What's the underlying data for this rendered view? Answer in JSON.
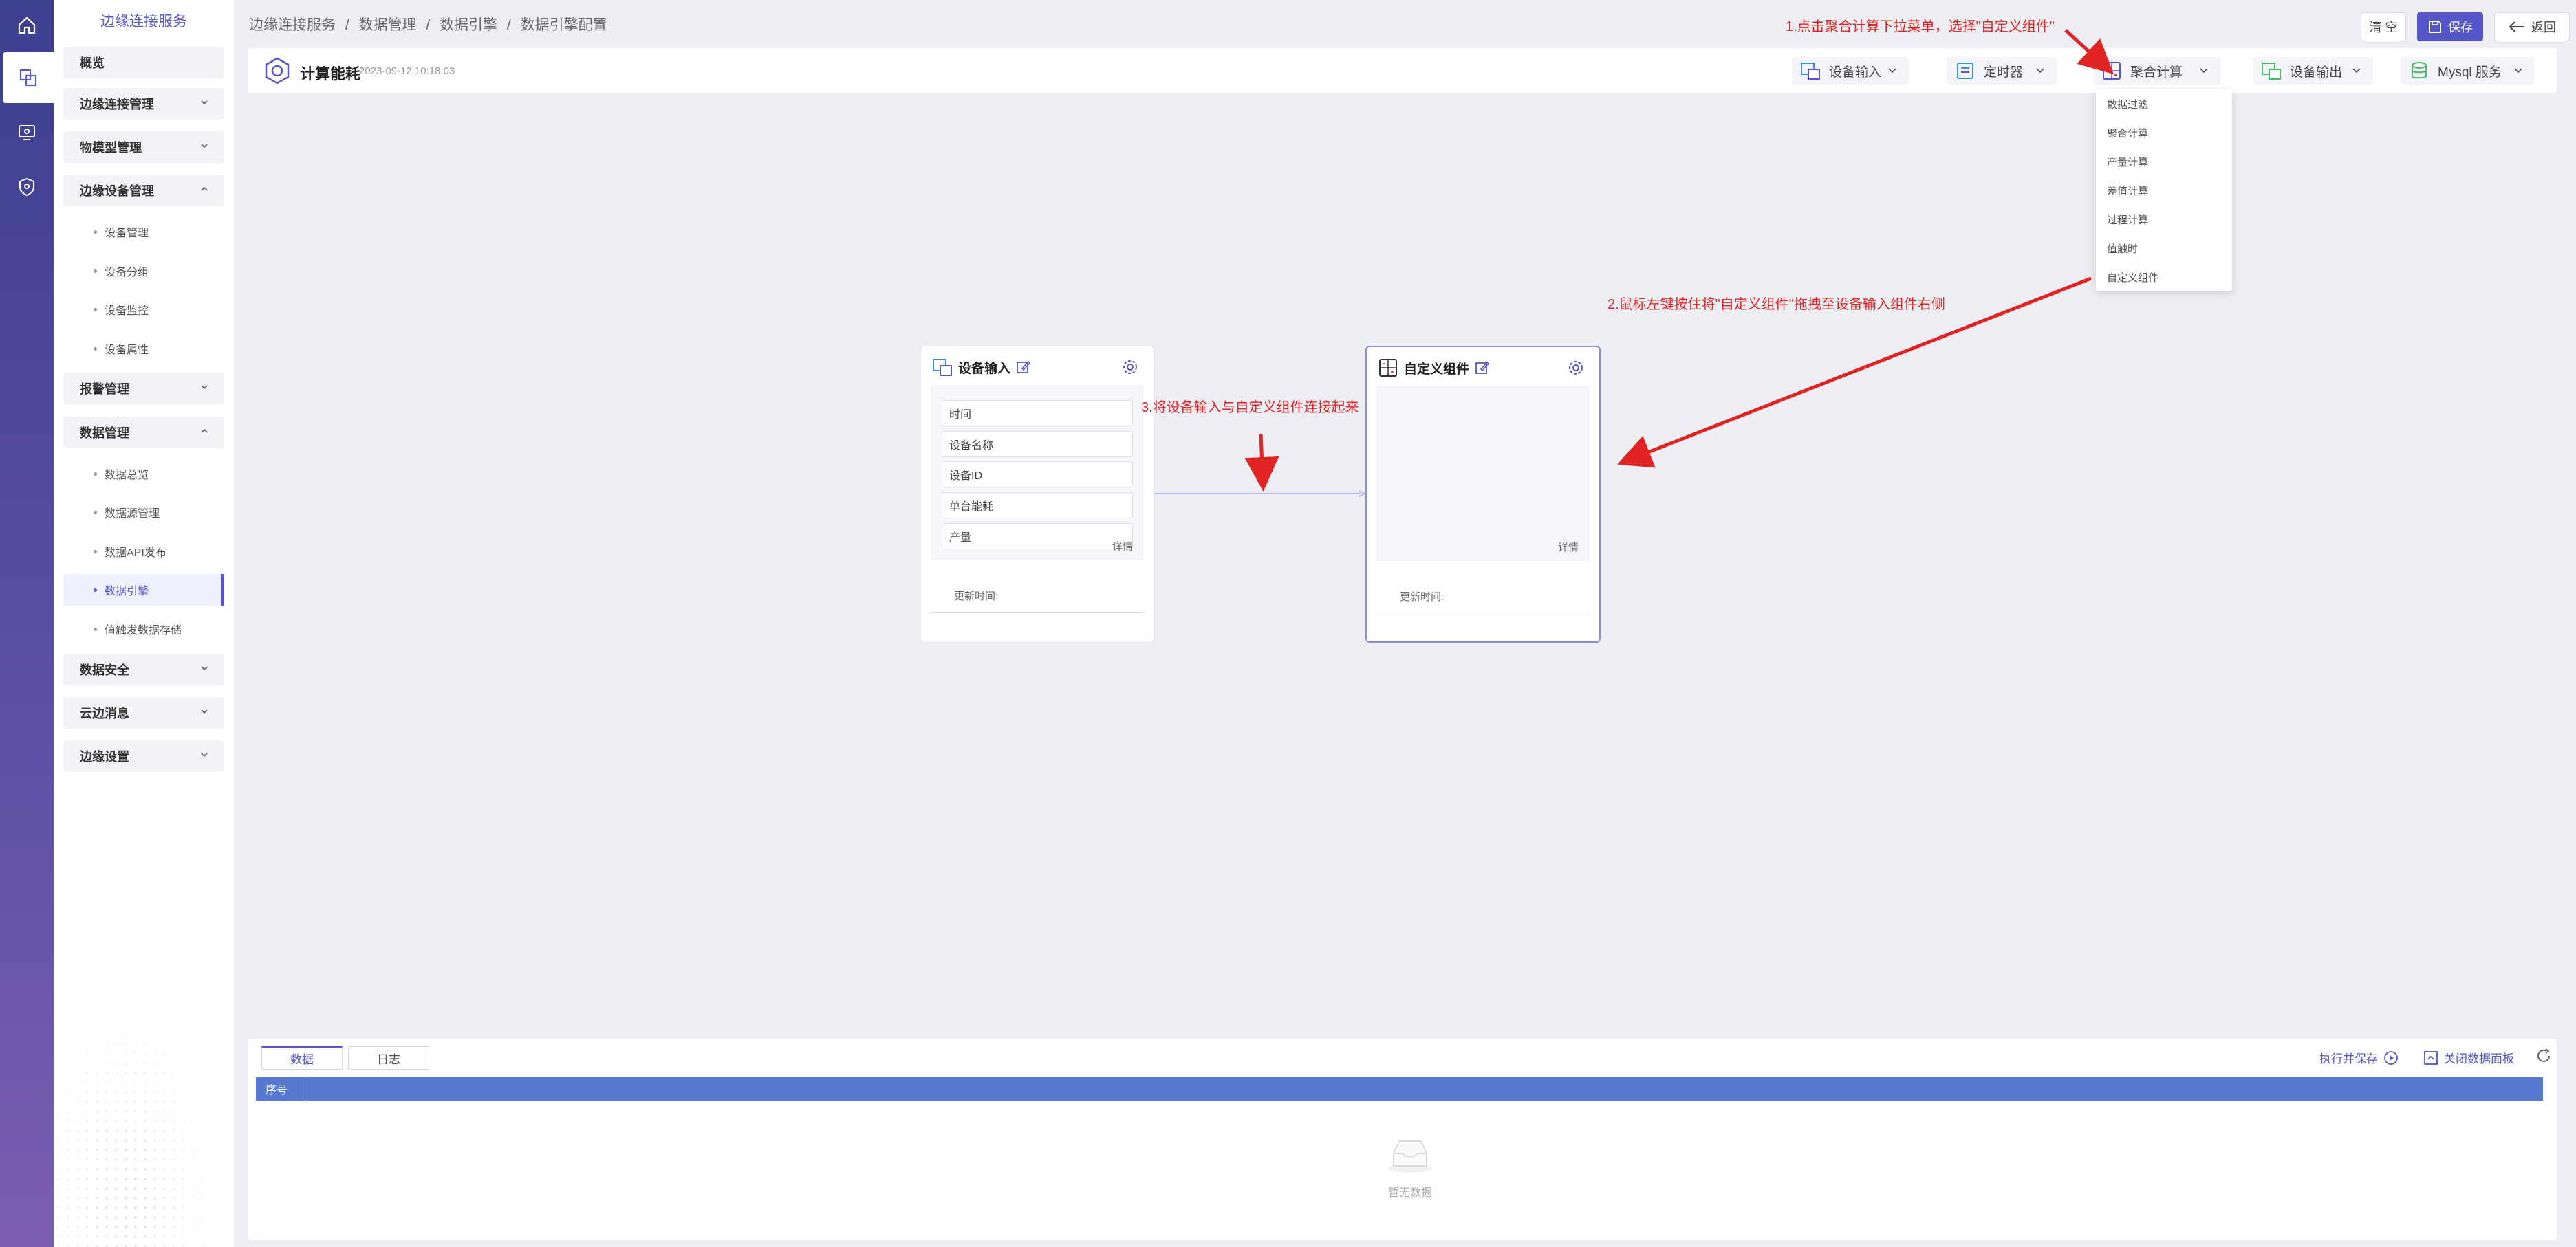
{
  "sidebar": {
    "title": "边缘连接服务",
    "items": [
      {
        "label": "概览"
      },
      {
        "label": "边缘连接管理"
      },
      {
        "label": "物模型管理"
      },
      {
        "label": "边缘设备管理"
      },
      {
        "label": "设备管理"
      },
      {
        "label": "设备分组"
      },
      {
        "label": "设备监控"
      },
      {
        "label": "设备属性"
      },
      {
        "label": "报警管理"
      },
      {
        "label": "数据管理"
      },
      {
        "label": "数据总览"
      },
      {
        "label": "数据源管理"
      },
      {
        "label": "数据API发布"
      },
      {
        "label": "数据引擎"
      },
      {
        "label": "值触发数据存储"
      },
      {
        "label": "数据安全"
      },
      {
        "label": "云边消息"
      },
      {
        "label": "边缘设置"
      }
    ]
  },
  "breadcrumb": [
    "边缘连接服务",
    "/",
    "数据管理",
    "/",
    "数据引擎",
    "/",
    "数据引擎配置"
  ],
  "header": {
    "clear_label": "清 空",
    "save_label": "保存",
    "back_label": "返回"
  },
  "toolbar": {
    "title": "计算能耗",
    "time": "2023-09-12 10:18:03",
    "buttons": {
      "device_input": "设备输入",
      "timer": "定时器",
      "aggregate": "聚合计算",
      "device_output": "设备输出",
      "mysql": "Mysql 服务"
    }
  },
  "dropdown": {
    "items": [
      "数据过滤",
      "聚合计算",
      "产量计算",
      "差值计算",
      "过程计算",
      "值触时",
      "自定义组件"
    ]
  },
  "nodes": {
    "input": {
      "title": "设备输入",
      "fields": [
        "时间",
        "设备名称",
        "设备ID",
        "单台能耗",
        "产量"
      ],
      "detail": "详情",
      "updated": "更新时间:"
    },
    "custom": {
      "title": "自定义组件",
      "detail": "详情",
      "updated": "更新时间:"
    }
  },
  "annotations": {
    "step1": "1.点击聚合计算下拉菜单，选择\"自定义组件\"",
    "step2": "2.鼠标左键按住将\"自定义组件\"拖拽至设备输入组件右侧",
    "step3": "3.将设备输入与自定义组件连接起来"
  },
  "panel": {
    "tabs": [
      "数据",
      "日志"
    ],
    "execute_save": "执行并保存",
    "close_panel": "关闭数据面板",
    "columns": [
      "序号"
    ],
    "empty_text": "暂无数据"
  },
  "colors": {
    "accent": "#5556c7",
    "annotation": "#e02424",
    "table_header": "#5578d0"
  }
}
